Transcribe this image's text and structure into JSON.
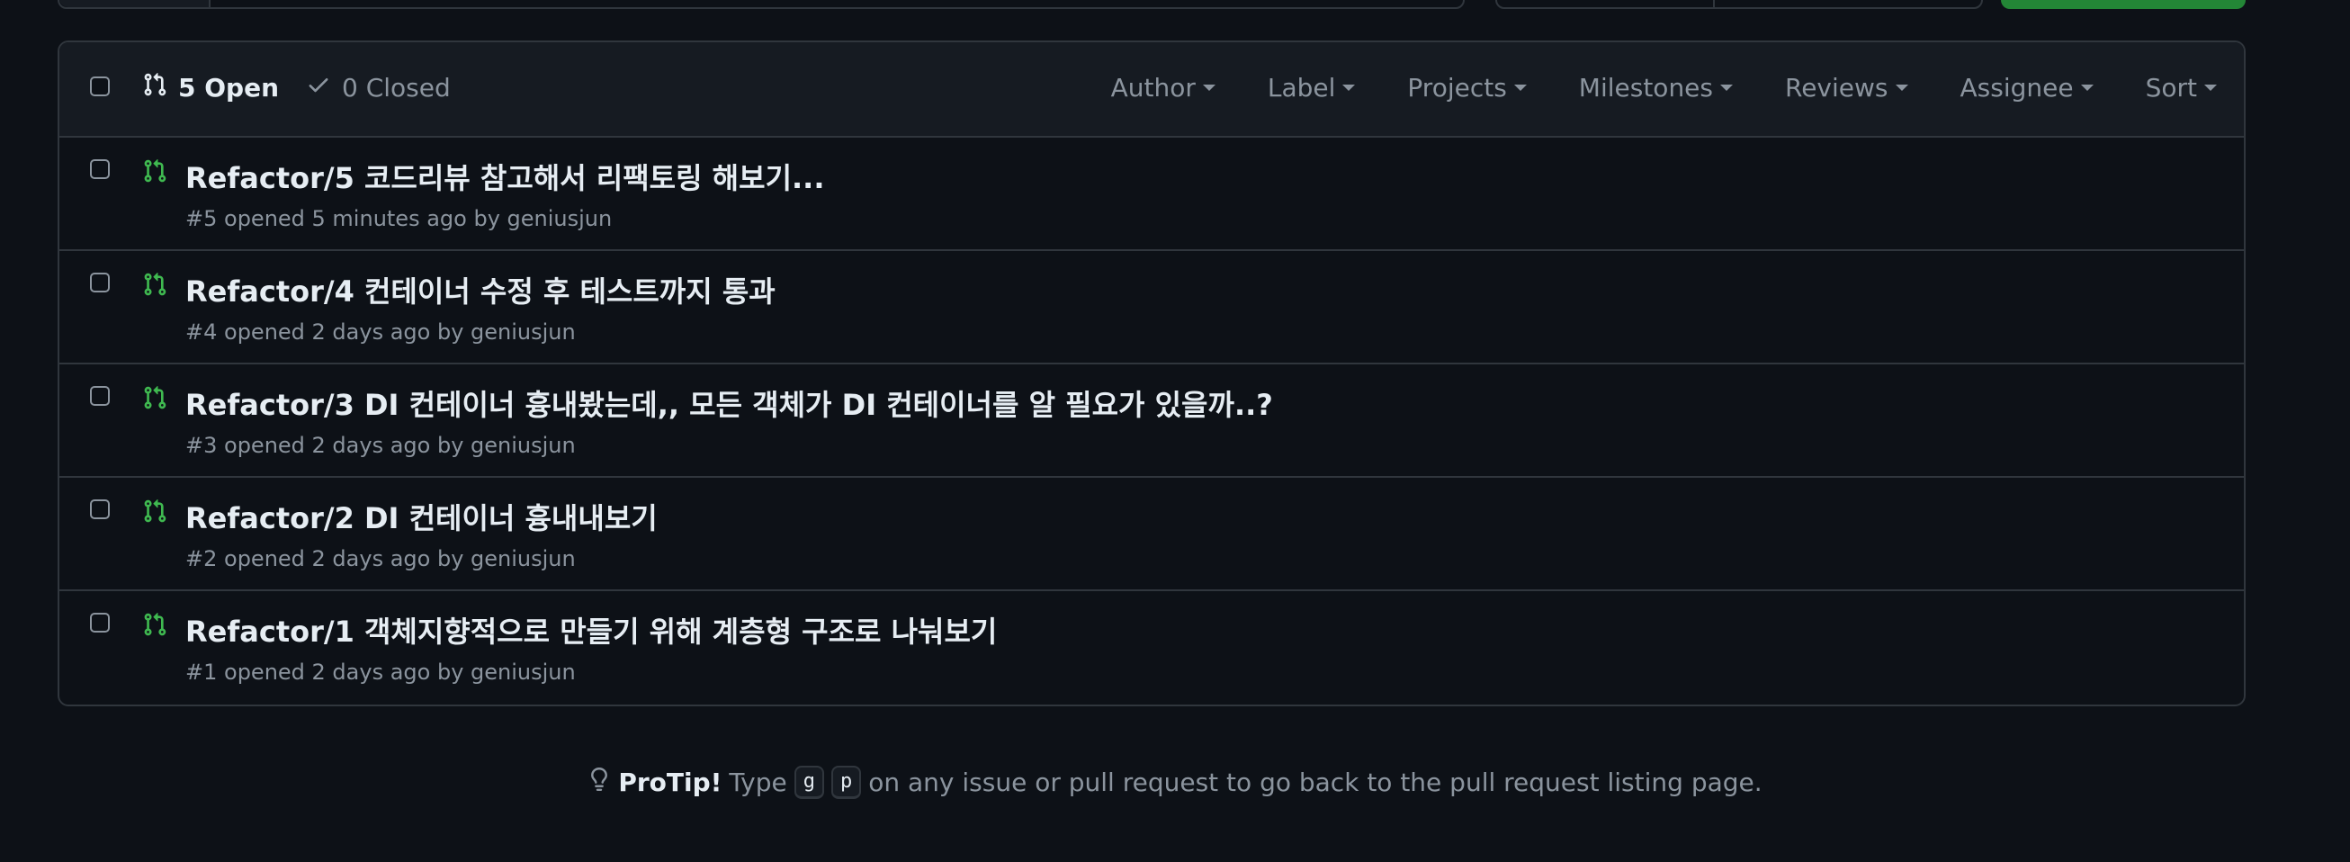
{
  "header": {
    "open_label": "5 Open",
    "closed_label": "0 Closed",
    "filters": [
      "Author",
      "Label",
      "Projects",
      "Milestones",
      "Reviews",
      "Assignee",
      "Sort"
    ]
  },
  "pull_requests": [
    {
      "title": "Refactor/5 코드리뷰 참고해서 리팩토링 해보기...",
      "meta": "#5 opened 5 minutes ago by geniusjun"
    },
    {
      "title": "Refactor/4 컨테이너 수정 후 테스트까지 통과",
      "meta": "#4 opened 2 days ago by geniusjun"
    },
    {
      "title": "Refactor/3 DI 컨테이너 흉내봤는데,, 모든 객체가 DI 컨테이너를 알 필요가 있을까..?",
      "meta": "#3 opened 2 days ago by geniusjun"
    },
    {
      "title": "Refactor/2 DI 컨테이너 흉내내보기",
      "meta": "#2 opened 2 days ago by geniusjun"
    },
    {
      "title": "Refactor/1 객체지향적으로 만들기 위해 계층형 구조로 나눠보기",
      "meta": "#1 opened 2 days ago by geniusjun"
    }
  ],
  "protip": {
    "label": "ProTip!",
    "text_before": "Type",
    "key1": "g",
    "key2": "p",
    "text_after": "on any issue or pull request to go back to the pull request listing page."
  },
  "colors": {
    "background": "#0d1117",
    "header_bg": "#161b22",
    "border": "#30363d",
    "open_icon": "#3fb950",
    "muted": "#8b949e"
  }
}
